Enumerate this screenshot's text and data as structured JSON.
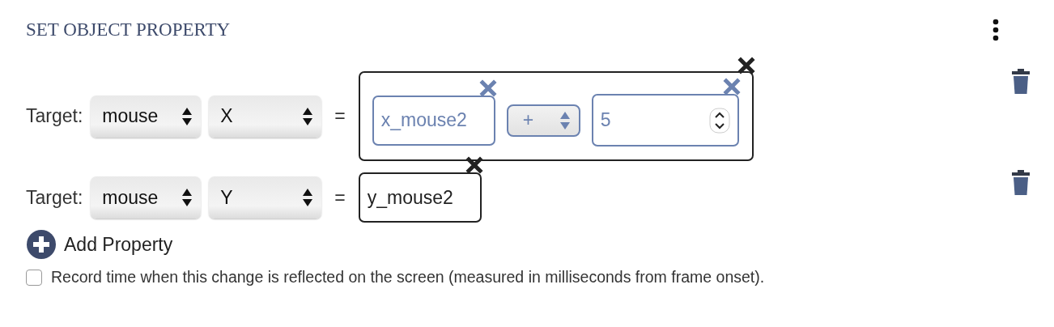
{
  "title": "SET OBJECT PROPERTY",
  "properties": [
    {
      "label": "Target:",
      "target_object": "mouse",
      "target_property": "X",
      "equals": "=",
      "value": {
        "kind": "expression",
        "items": [
          {
            "kind": "variable",
            "text": "x_mouse2"
          },
          {
            "kind": "operator",
            "text": "+"
          },
          {
            "kind": "number",
            "text": "5"
          }
        ]
      }
    },
    {
      "label": "Target:",
      "target_object": "mouse",
      "target_property": "Y",
      "equals": "=",
      "value": {
        "kind": "variable",
        "text": "y_mouse2"
      }
    }
  ],
  "add_property": "Add Property",
  "record_time": {
    "label": "Record time when this change is reflected on the screen (measured in milliseconds from frame onset).",
    "checked": false
  }
}
